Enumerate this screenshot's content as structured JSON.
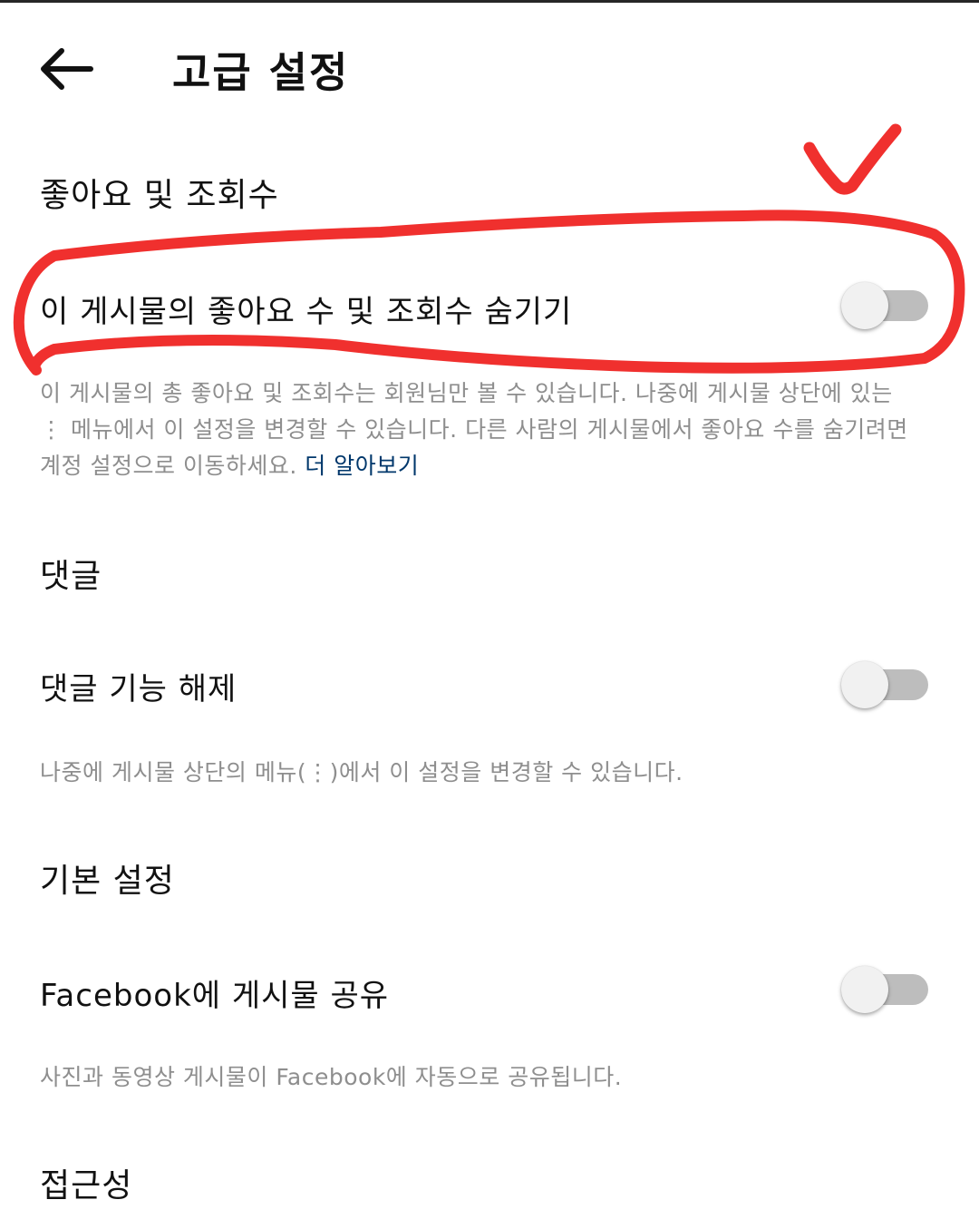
{
  "header": {
    "title": "고급 설정",
    "back_icon": "arrow-left-icon"
  },
  "likes_section": {
    "title": "좋아요 및 조회수",
    "toggle_label": "이 게시물의 좋아요 수 및 조회수 숨기기",
    "toggle_on": false,
    "description": "이 게시물의 총 좋아요 및 조회수는 회원님만 볼 수 있습니다. 나중에 게시물 상단에 있는 ⋮ 메뉴에서 이 설정을 변경할 수 있습니다. 다른 사람의 게시물에서 좋아요 수를 숨기려면 계정 설정으로 이동하세요.",
    "learn_more": "더 알아보기"
  },
  "comments_section": {
    "title": "댓글",
    "toggle_label": "댓글 기능 해제",
    "toggle_on": false,
    "description": "나중에 게시물 상단의 메뉴(⋮)에서 이 설정을 변경할 수 있습니다."
  },
  "basic_section": {
    "title": "기본 설정",
    "toggle_label": "Facebook에 게시물 공유",
    "toggle_on": false,
    "description": "사진과 동영상 게시물이 Facebook에 자동으로 공유됩니다."
  },
  "accessibility_section": {
    "title": "접근성"
  },
  "colors": {
    "annotation_red": "#f0302e",
    "link_blue": "#00376b",
    "secondary_text": "#8e8e8e",
    "toggle_track_off": "#bdbdbd"
  }
}
